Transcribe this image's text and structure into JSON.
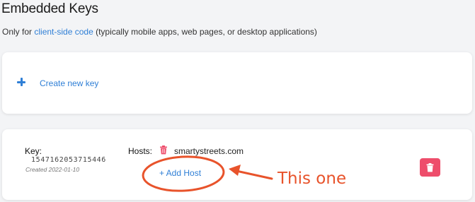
{
  "header": {
    "title": "Embedded Keys",
    "subtitle_prefix": "Only for ",
    "subtitle_link": "client-side code",
    "subtitle_suffix": " (typically mobile apps, web pages, or desktop applications)"
  },
  "create_card": {
    "label": "Create new key",
    "icon": "plus-icon"
  },
  "key_card": {
    "key_label": "Key:",
    "key_value": "1547162053715446",
    "created": "Created 2022-01-10",
    "hosts_label": "Hosts:",
    "hosts": [
      "smartystreets.com"
    ],
    "add_host_label": "+ Add Host",
    "delete_icon": "trash-icon"
  },
  "annotation": {
    "text": "This one",
    "color": "#e8532b"
  },
  "colors": {
    "accent": "#2f7fd6",
    "danger": "#ee4d6b",
    "background": "#f3f4f6"
  }
}
